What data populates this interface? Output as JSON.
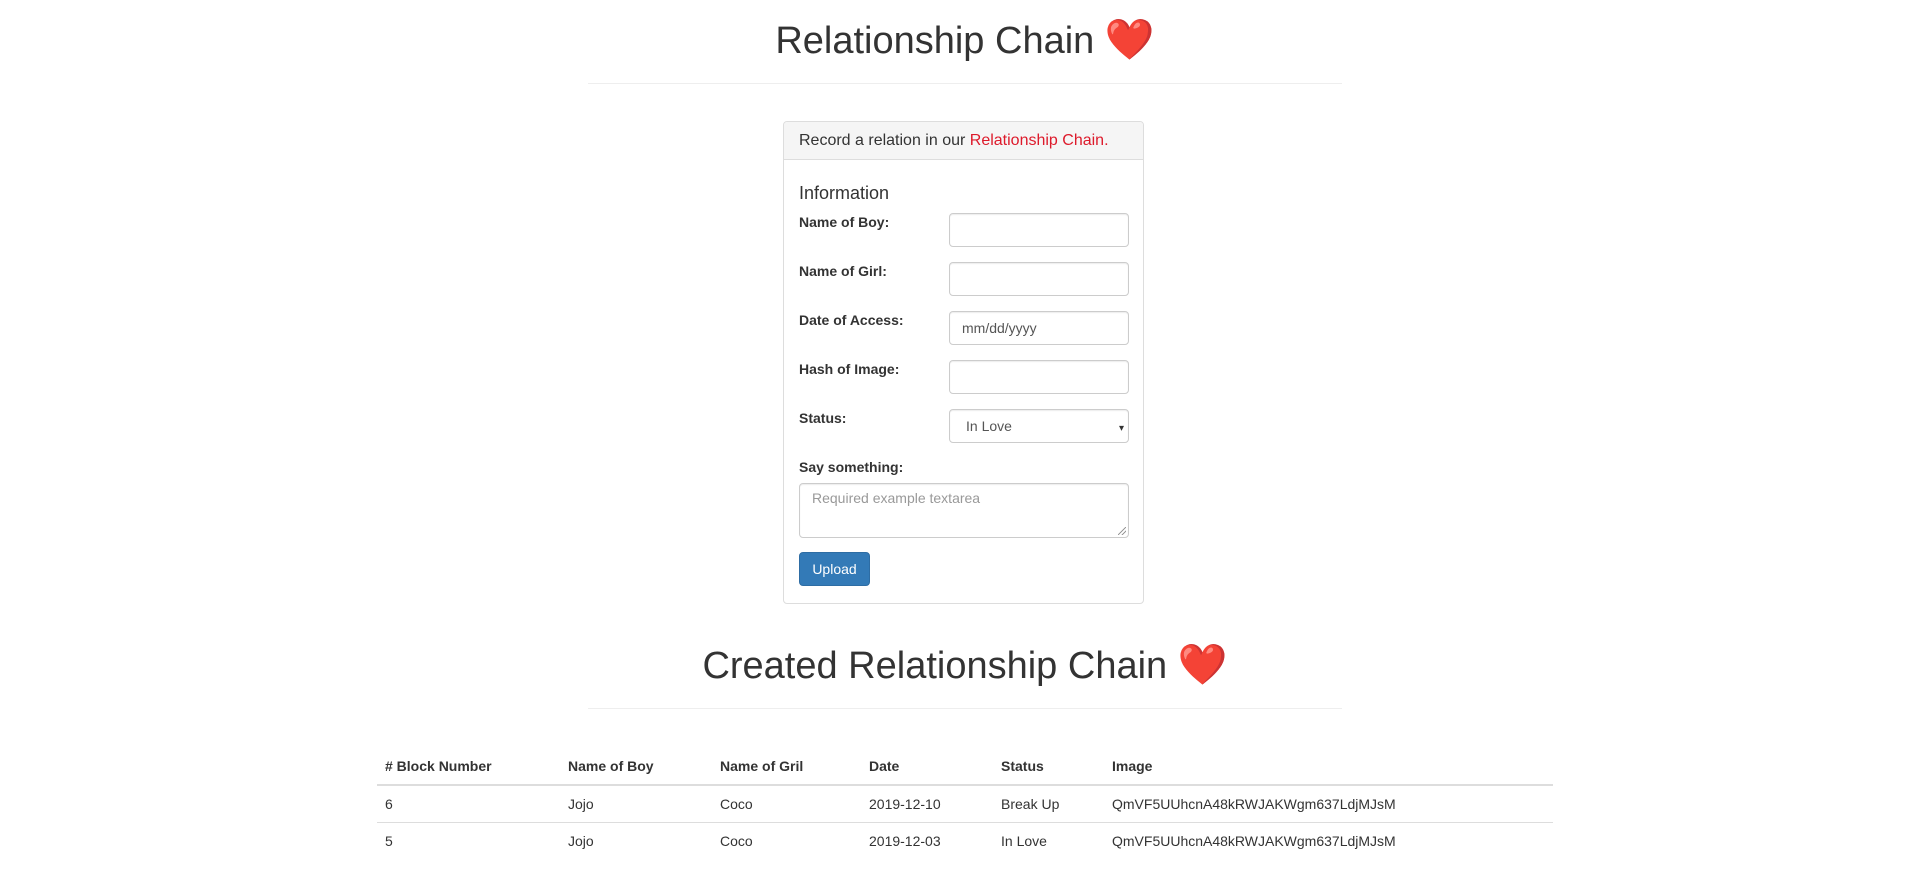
{
  "header": {
    "title": "Relationship Chain",
    "heart": "❤️"
  },
  "form": {
    "heading_prefix": "Record a relation in our ",
    "heading_brand": "Relationship Chain.",
    "section_title": "Information",
    "boy_label": "Name of Boy:",
    "boy_value": "",
    "girl_label": "Name of Girl:",
    "girl_value": "",
    "date_label": "Date of Access:",
    "date_placeholder": "mm/dd/yyyy",
    "hash_label": "Hash of Image:",
    "hash_value": "",
    "status_label": "Status:",
    "status_selected": "In Love",
    "say_label": "Say something:",
    "say_placeholder": "Required example textarea",
    "upload_label": "Upload"
  },
  "created": {
    "title": "Created Relationship Chain",
    "heart": "❤️",
    "columns": [
      "# Block Number",
      "Name of Boy",
      "Name of Gril",
      "Date",
      "Status",
      "Image"
    ],
    "rows": [
      [
        "6",
        "Jojo",
        "Coco",
        "2019-12-10",
        "Break Up",
        "QmVF5UUhcnA48kRWJAKWgm637LdjMJsM"
      ],
      [
        "5",
        "Jojo",
        "Coco",
        "2019-12-03",
        "In Love",
        "QmVF5UUhcnA48kRWJAKWgm637LdjMJsM"
      ]
    ]
  },
  "colors": {
    "accent": "#dd1a2b",
    "primary_button": "#337ab7"
  }
}
